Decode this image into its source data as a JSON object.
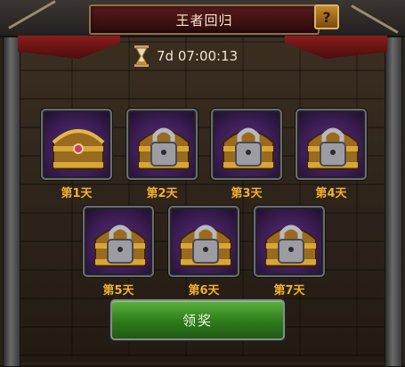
{
  "header": {
    "title": "王者回归",
    "help_label": "?"
  },
  "timer": {
    "countdown": "7d 07:00:13"
  },
  "rewards": {
    "days": [
      {
        "label": "第1天",
        "status": "unlocked"
      },
      {
        "label": "第2天",
        "status": "locked"
      },
      {
        "label": "第3天",
        "status": "locked"
      },
      {
        "label": "第4天",
        "status": "locked"
      },
      {
        "label": "第5天",
        "status": "locked"
      },
      {
        "label": "第6天",
        "status": "locked"
      },
      {
        "label": "第7天",
        "status": "locked"
      }
    ]
  },
  "actions": {
    "claim_label": "领奖"
  },
  "icons": {
    "chest": "treasure-chest-icon",
    "lock": "padlock-icon",
    "timer": "hourglass-icon",
    "help": "question-mark-icon"
  },
  "colors": {
    "day_label": "#f2b030",
    "slot_bg": "#3c1d55",
    "button_green": "#2e7a1c",
    "title_red": "#5a1c1c"
  }
}
